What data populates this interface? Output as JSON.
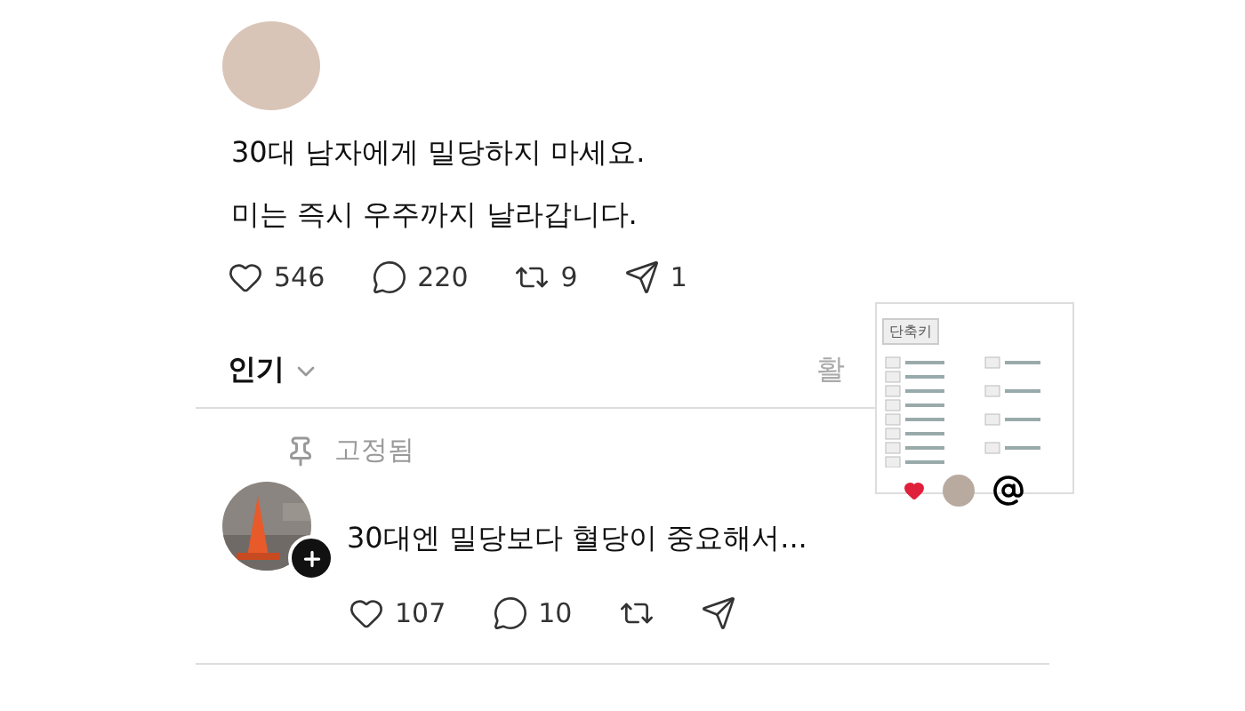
{
  "post": {
    "lines": [
      "30대 남자에게 밀당하지 마세요.",
      "미는 즉시 우주까지 날라갑니다."
    ],
    "actions": [
      {
        "kind": "like",
        "count": "546"
      },
      {
        "kind": "reply",
        "count": "220"
      },
      {
        "kind": "repost",
        "count": "9"
      },
      {
        "kind": "share",
        "count": "1"
      }
    ]
  },
  "sort": {
    "label": "인기",
    "activity_link": "활"
  },
  "shortcuts_popup": {
    "title": "단축키"
  },
  "pinned": {
    "label": "고정됨",
    "text": "30대엔 밀당보다 혈당이 중요해서...",
    "actions": [
      {
        "kind": "like",
        "count": "107"
      },
      {
        "kind": "reply",
        "count": "10"
      },
      {
        "kind": "repost"
      },
      {
        "kind": "share"
      }
    ]
  }
}
